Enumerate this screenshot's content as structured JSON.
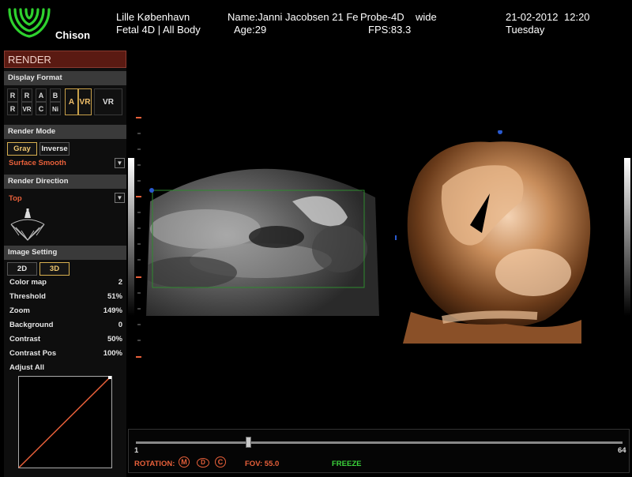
{
  "header": {
    "logo_text": "Chison",
    "hospital": "Lille København",
    "preset": "Fetal 4D | All Body",
    "patient_name": "Name:Janni Jacobsen 21 Fe",
    "age": "Age:29",
    "probe": "Probe-4D",
    "probe_mode": "wide",
    "fps": "FPS:83.3",
    "date": "21-02-2012",
    "time": "12:20",
    "day": "Tuesday"
  },
  "panel": {
    "title": "RENDER",
    "display_format": {
      "label": "Display Format",
      "buttons": [
        "R",
        "R",
        "A",
        "B",
        "R",
        "VR",
        "C",
        "Ni"
      ],
      "active_a": "A",
      "active_vr": "VR",
      "single_vr": "VR"
    },
    "render_mode": {
      "label": "Render Mode",
      "gray": "Gray",
      "inverse": "Inverse",
      "mode_value": "Surface Smooth"
    },
    "render_direction": {
      "label": "Render Direction",
      "value": "Top"
    },
    "image_setting": {
      "label": "Image Setting",
      "btn_2d": "2D",
      "btn_3d": "3D",
      "params": [
        {
          "label": "Color map",
          "value": "2"
        },
        {
          "label": "Threshold",
          "value": "51%"
        },
        {
          "label": "Zoom",
          "value": "149%"
        },
        {
          "label": "Background",
          "value": "0"
        },
        {
          "label": "Contrast",
          "value": "50%"
        },
        {
          "label": "Contrast Pos",
          "value": "100%"
        },
        {
          "label": "Adjust All",
          "value": ""
        }
      ]
    }
  },
  "bottom": {
    "slider_min": "1",
    "slider_max": "64",
    "slider_position": 0.23,
    "rotation_label": "ROTATION:",
    "rot_m": "M",
    "rot_d": "D",
    "rot_c": "C",
    "fov": "FOV: 55.0",
    "freeze": "FREEZE"
  },
  "colors": {
    "accent_orange": "#e8603a",
    "freeze_green": "#3cd43c",
    "roi_green": "#2e8a2e",
    "panel_title_bg": "#5a1a12"
  }
}
